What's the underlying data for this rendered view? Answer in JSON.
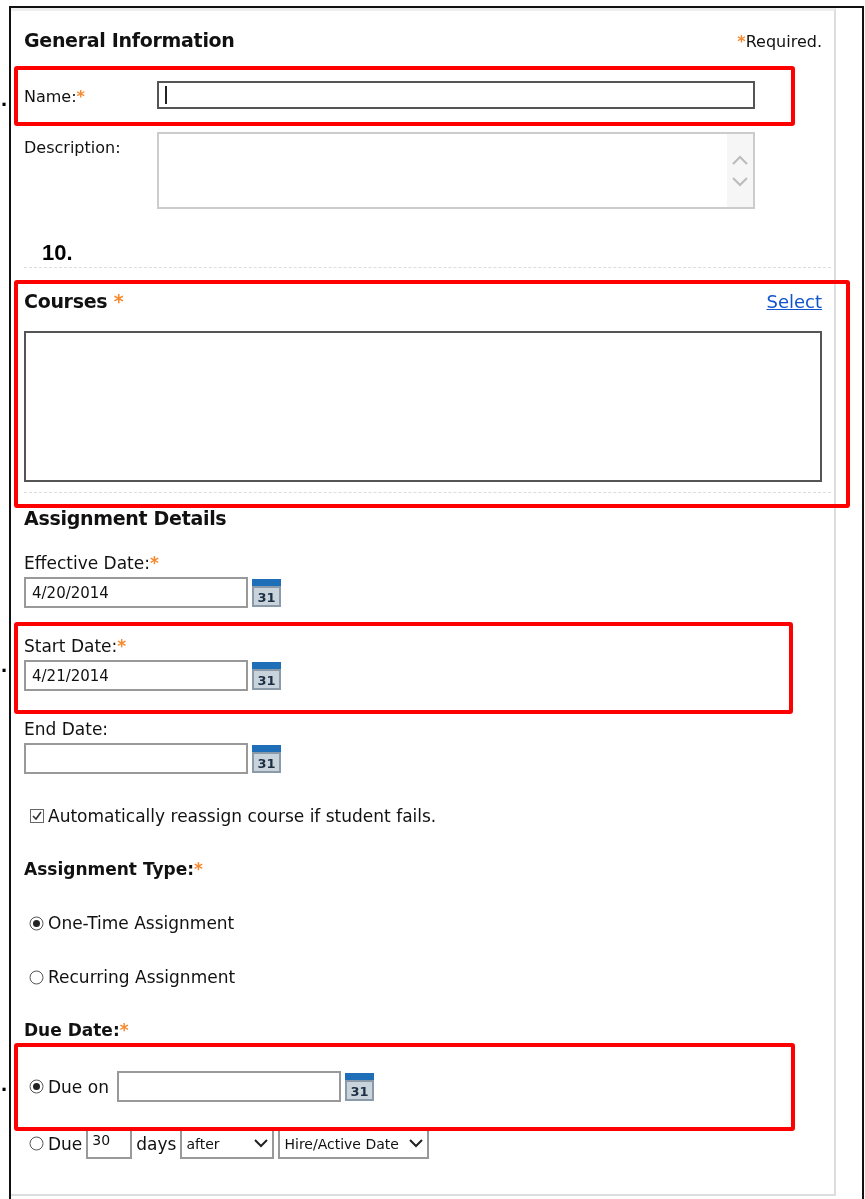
{
  "general_information": {
    "title": "General Information",
    "required_note": {
      "mark": "*",
      "text": "Required."
    },
    "fields": [
      {
        "kind": "text",
        "label": "Name:",
        "mark": "*",
        "focused": true
      },
      {
        "kind": "textarea",
        "label": "Description:"
      }
    ]
  },
  "courses": {
    "title": "Courses",
    "mark": "*",
    "link": "Select"
  },
  "assignment_details": {
    "title": "Assignment Details",
    "dates": [
      {
        "label": "Effective Date:",
        "mark": "*",
        "value": "4/20/2014",
        "calendar_day": "31"
      },
      {
        "label": "Start Date:",
        "mark": "*",
        "value": "4/21/2014",
        "calendar_day": "31"
      },
      {
        "label": "End Date:",
        "calendar_day": "31"
      }
    ],
    "auto_reassign": {
      "label": "Automatically reassign course if student fails.",
      "checked": true
    },
    "assignment_type": {
      "label": "Assignment Type:",
      "mark": "*",
      "options": [
        {
          "label": "One-Time Assignment",
          "selected": true
        },
        {
          "label": "Recurring Assignment",
          "selected": false
        }
      ]
    },
    "due_date": {
      "label": "Due Date:",
      "mark": "*",
      "options": [
        {
          "kind": "date",
          "label": "Due on",
          "selected": true,
          "calendar_day": "31"
        },
        {
          "kind": "relative",
          "label": "Due",
          "days": "30",
          "unit": "days",
          "direction": "after",
          "reference": "Hire/Active Date",
          "selected": false
        }
      ]
    }
  },
  "annotations": [
    {
      "label": "."
    },
    {
      "label": "10."
    },
    {
      "label": "."
    },
    {
      "label": "."
    }
  ]
}
